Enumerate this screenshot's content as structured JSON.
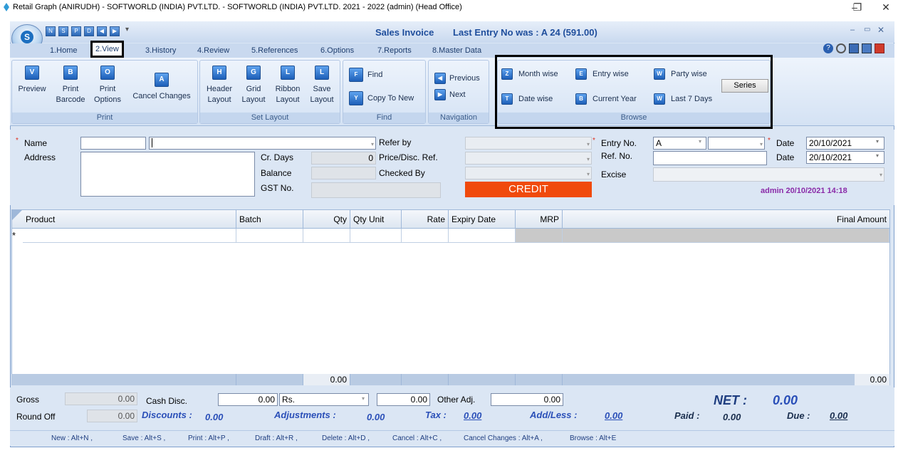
{
  "titlebar": {
    "title": "Retail Graph (ANIRUDH) - SOFTWORLD (INDIA) PVT.LTD. - SOFTWORLD (INDIA) PVT.LTD.  2021 - 2022 (admin) (Head Office)"
  },
  "window": {
    "caption": "Sales Invoice",
    "last_entry": "Last Entry No was : A 24   (591.00)"
  },
  "tabs": [
    "1.Home",
    "2.View",
    "3.History",
    "4.Review",
    "5.References",
    "6.Options",
    "7.Reports",
    "8.Master Data"
  ],
  "ribbon": {
    "print_group": {
      "label": "Print",
      "preview": "Preview",
      "print_barcode_1": "Print",
      "print_barcode_2": "Barcode",
      "print_options_1": "Print",
      "print_options_2": "Options",
      "cancel_changes": "Cancel Changes"
    },
    "layout_group": {
      "label": "Set Layout",
      "header_1": "Header",
      "header_2": "Layout",
      "grid_1": "Grid",
      "grid_2": "Layout",
      "ribbon_1": "Ribbon",
      "ribbon_2": "Layout",
      "save_1": "Save",
      "save_2": "Layout"
    },
    "find_group": {
      "label": "Find",
      "find": "Find",
      "copy_to_new": "Copy To New"
    },
    "nav_group": {
      "label": "Navigation",
      "previous": "Previous",
      "next": "Next"
    },
    "browse_group": {
      "label": "Browse",
      "month_wise": "Month wise",
      "entry_wise": "Entry wise",
      "party_wise": "Party wise",
      "date_wise": "Date wise",
      "current_year": "Current Year",
      "last_7_days": "Last 7 Days",
      "series": "Series"
    }
  },
  "form": {
    "name_label": "Name",
    "address_label": "Address",
    "cr_days_label": "Cr. Days",
    "cr_days_value": "0",
    "balance_label": "Balance",
    "gst_label": "GST No.",
    "refer_by_label": "Refer by",
    "price_disc_label": "Price/Disc. Ref.",
    "checked_by_label": "Checked By",
    "credit": "CREDIT",
    "entry_no_label": "Entry No.",
    "entry_no_value": "A",
    "ref_no_label": "Ref. No.",
    "excise_label": "Excise",
    "date_label": "Date",
    "date_value": "20/10/2021",
    "date2_label": "Date",
    "date2_value": "20/10/2021",
    "user_stamp": "admin 20/10/2021 14:18"
  },
  "grid": {
    "columns": [
      "Product",
      "Batch",
      "Qty",
      "Qty Unit",
      "Rate",
      "Expiry Date",
      "MRP",
      "Final Amount"
    ],
    "new_row_marker": "*",
    "qty_total": "0.00",
    "amount_total": "0.00"
  },
  "totals": {
    "gross_label": "Gross",
    "gross_value": "0.00",
    "round_off_label": "Round Off",
    "round_off_value": "0.00",
    "cash_disc_label": "Cash Disc.",
    "cash_disc_value": "0.00",
    "cash_disc_unit": "Rs.",
    "cash_disc_amt": "0.00",
    "other_adj_label": "Other Adj.",
    "other_adj_value": "0.00",
    "discounts_label": "Discounts :",
    "discounts_value": "0.00",
    "adjustments_label": "Adjustments :",
    "adjustments_value": "0.00",
    "tax_label": "Tax :",
    "tax_value": "0.00",
    "addless_label": "Add/Less :",
    "addless_value": "0.00",
    "net_label": "NET :",
    "net_value": "0.00",
    "paid_label": "Paid :",
    "paid_value": "0.00",
    "due_label": "Due :",
    "due_value": "0.00"
  },
  "status": [
    "New : Alt+N ,",
    "Save : Alt+S ,",
    "Print : Alt+P ,",
    "Draft : Alt+R ,",
    "Delete : Alt+D ,",
    "Cancel : Alt+C ,",
    "Cancel Changes : Alt+A ,",
    "Browse : Alt+E"
  ],
  "colors": {
    "accent": "#1f4e9c",
    "credit": "#f04a0c",
    "stamp": "#8a2aa8"
  }
}
